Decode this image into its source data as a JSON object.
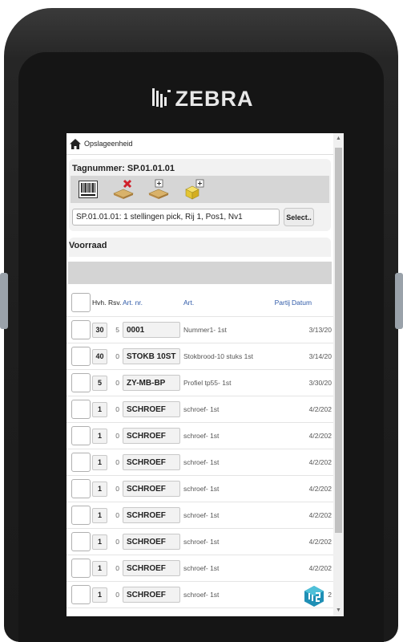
{
  "device": {
    "brand": "ZEBRA"
  },
  "header": {
    "title": "Opslageenheid"
  },
  "tag_panel": {
    "title": "Tagnummer: SP.01.01.01",
    "tools": [
      "barcode-icon",
      "delete-pallet-icon",
      "add-pallet-icon",
      "add-box-icon"
    ],
    "location_value": "SP.01.01.01: 1 stellingen pick, Rij 1, Pos1, Nv1",
    "select_label": "Select.."
  },
  "stock": {
    "title": "Voorraad",
    "columns": {
      "hvh": "Hvh.",
      "rsv": "Rsv.",
      "artnr": "Art. nr.",
      "art": "Art.",
      "partij": "Partij",
      "datum": "Datum"
    },
    "rows": [
      {
        "hvh": "30",
        "rsv": "5",
        "artnr": "0001",
        "art": "Nummer1- 1st",
        "datum": "3/13/20"
      },
      {
        "hvh": "40",
        "rsv": "0",
        "artnr": "STOKB 10ST",
        "art": "Stokbrood-10 stuks 1st",
        "datum": "3/14/20"
      },
      {
        "hvh": "5",
        "rsv": "0",
        "artnr": "ZY-MB-BP",
        "art": "Profiel tp55- 1st",
        "datum": "3/30/20"
      },
      {
        "hvh": "1",
        "rsv": "0",
        "artnr": "SCHROEF",
        "art": "schroef- 1st",
        "datum": "4/2/202"
      },
      {
        "hvh": "1",
        "rsv": "0",
        "artnr": "SCHROEF",
        "art": "schroef- 1st",
        "datum": "4/2/202"
      },
      {
        "hvh": "1",
        "rsv": "0",
        "artnr": "SCHROEF",
        "art": "schroef- 1st",
        "datum": "4/2/202"
      },
      {
        "hvh": "1",
        "rsv": "0",
        "artnr": "SCHROEF",
        "art": "schroef- 1st",
        "datum": "4/2/202"
      },
      {
        "hvh": "1",
        "rsv": "0",
        "artnr": "SCHROEF",
        "art": "schroef- 1st",
        "datum": "4/2/202"
      },
      {
        "hvh": "1",
        "rsv": "0",
        "artnr": "SCHROEF",
        "art": "schroef- 1st",
        "datum": "4/2/202"
      },
      {
        "hvh": "1",
        "rsv": "0",
        "artnr": "SCHROEF",
        "art": "schroef- 1st",
        "datum": "4/2/202"
      },
      {
        "hvh": "1",
        "rsv": "0",
        "artnr": "SCHROEF",
        "art": "schroef- 1st",
        "datum": "2"
      }
    ]
  },
  "colors": {
    "link_blue": "#2f5aa8",
    "device_body": "#1e1e1e",
    "panel_bg": "#f2f2f2",
    "bar_gray": "#d4d4d4"
  }
}
